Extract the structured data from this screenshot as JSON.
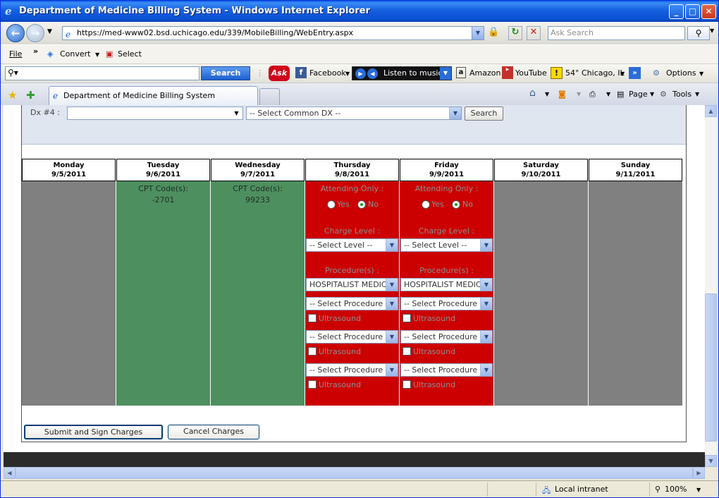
{
  "window": {
    "title": "Department of Medicine Billing System - Windows Internet Explorer"
  },
  "address": {
    "url": "https://med-www02.bsd.uchicago.edu/339/MobileBilling/WebEntry.aspx",
    "search_placeholder": "Ask Search"
  },
  "menu": {
    "file": "File",
    "chevrons": "»",
    "convert": "Convert",
    "select": "Select"
  },
  "ask_toolbar": {
    "search_button": "Search",
    "ask_logo": "Ask",
    "facebook": "Facebook",
    "music": "Listen to music",
    "amazon": "Amazon",
    "youtube": "YouTube",
    "weather": "54° Chicago, IL",
    "options": "Options"
  },
  "tabs": {
    "active": "Department of Medicine Billing System",
    "home": "⌂",
    "page": "Page",
    "tools": "Tools"
  },
  "dx": {
    "label": "Dx #4 :",
    "selected": "",
    "common_placeholder": "-- Select Common DX --",
    "search_button": "Search"
  },
  "days": [
    {
      "name": "Monday",
      "date": "9/5/2011",
      "type": "empty"
    },
    {
      "name": "Tuesday",
      "date": "9/6/2011",
      "type": "billed",
      "cpt_label": "CPT Code(s):",
      "cpt_value": "-2701"
    },
    {
      "name": "Wednesday",
      "date": "9/7/2011",
      "type": "billed",
      "cpt_label": "CPT Code(s):",
      "cpt_value": "99233"
    },
    {
      "name": "Thursday",
      "date": "9/8/2011",
      "type": "entry"
    },
    {
      "name": "Friday",
      "date": "9/9/2011",
      "type": "entry"
    },
    {
      "name": "Saturday",
      "date": "9/10/2011",
      "type": "empty"
    },
    {
      "name": "Sunday",
      "date": "9/11/2011",
      "type": "empty"
    }
  ],
  "entry_form": {
    "attending_only": "Attending Only :",
    "yes": "Yes",
    "no": "No",
    "selected_option": "No",
    "charge_level": "Charge Level :",
    "level_placeholder": "-- Select Level --",
    "procedures": "Procedure(s) :",
    "first_procedure": "HOSPITALIST MEDICINE",
    "procedure_placeholder": "-- Select Procedure --",
    "ultrasound": "Ultrasound"
  },
  "actions": {
    "submit": "Submit and Sign Charges",
    "cancel": "Cancel Charges"
  },
  "status": {
    "zone": "Local intranet",
    "zoom": "100%"
  }
}
